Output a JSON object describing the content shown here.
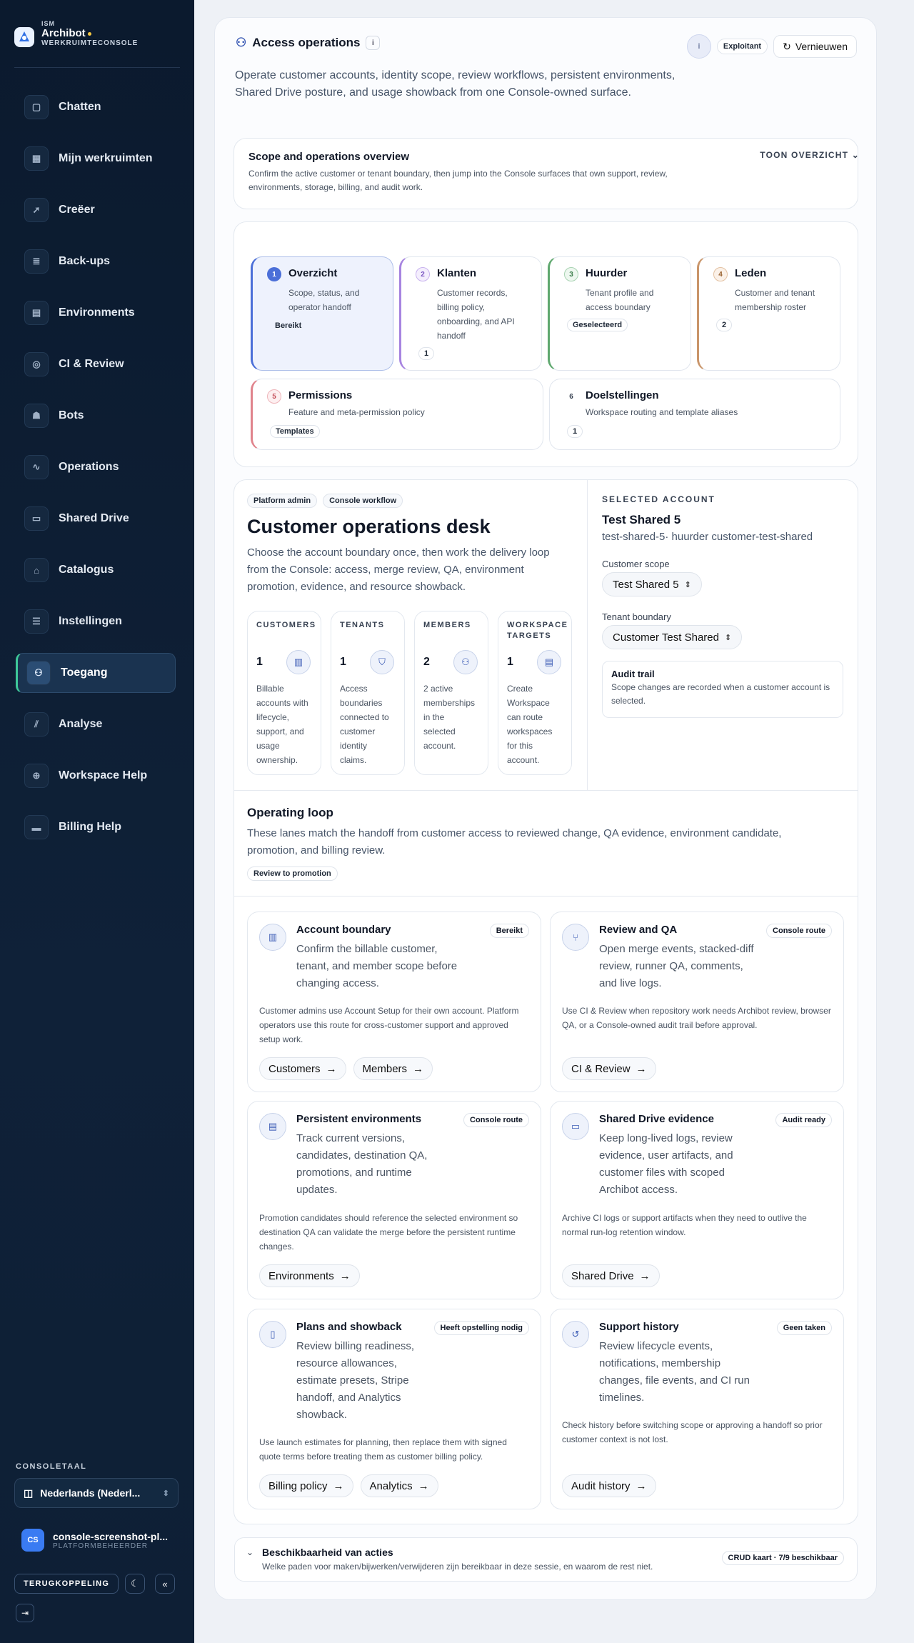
{
  "sidebar": {
    "brand_small": "ISM",
    "brand_name": "Archibot",
    "brand_sub": "WERKRUIMTECONSOLE",
    "items": [
      {
        "label": "Chatten",
        "icon": "chat-icon"
      },
      {
        "label": "Mijn werkruimten",
        "icon": "grid-icon"
      },
      {
        "label": "Creëer",
        "icon": "rocket-icon"
      },
      {
        "label": "Back-ups",
        "icon": "database-icon"
      },
      {
        "label": "Environments",
        "icon": "server-icon"
      },
      {
        "label": "CI & Review",
        "icon": "check-circle-icon"
      },
      {
        "label": "Bots",
        "icon": "bot-icon"
      },
      {
        "label": "Operations",
        "icon": "activity-icon"
      },
      {
        "label": "Shared Drive",
        "icon": "folder-icon"
      },
      {
        "label": "Catalogus",
        "icon": "store-icon"
      },
      {
        "label": "Instellingen",
        "icon": "sliders-icon"
      },
      {
        "label": "Toegang",
        "icon": "users-icon",
        "active": true
      },
      {
        "label": "Analyse",
        "icon": "chart-icon"
      },
      {
        "label": "Workspace Help",
        "icon": "lifebuoy-icon"
      },
      {
        "label": "Billing Help",
        "icon": "card-icon"
      }
    ],
    "lang_label": "CONSOLETAAL",
    "lang_value": "Nederlands (Nederl...",
    "user_initials": "CS",
    "user_name": "console-screenshot-pl...",
    "user_role": "PLATFORMBEHEERDER",
    "feedback": "TERUGKOPPELING"
  },
  "header": {
    "title": "Access operations",
    "role_badge": "Exploitant",
    "refresh": "Vernieuwen",
    "description": "Operate customer accounts, identity scope, review workflows, persistent environments, Shared Drive posture, and usage showback from one Console-owned surface."
  },
  "overview": {
    "title": "Scope and operations overview",
    "description": "Confirm the active customer or tenant boundary, then jump into the Console surfaces that own support, review, environments, storage, billing, and audit work.",
    "toggle": "TOON OVERZICHT"
  },
  "steps": [
    {
      "num": "1",
      "title": "Overzicht",
      "desc": "Scope, status, and operator handoff",
      "badge": "Bereikt"
    },
    {
      "num": "2",
      "title": "Klanten",
      "desc": "Customer records, billing policy, onboarding, and API handoff",
      "badge": "1"
    },
    {
      "num": "3",
      "title": "Huurder",
      "desc": "Tenant profile and access boundary",
      "badge": "Geselecteerd"
    },
    {
      "num": "4",
      "title": "Leden",
      "desc": "Customer and tenant membership roster",
      "badge": "2"
    },
    {
      "num": "5",
      "title": "Permissions",
      "desc": "Feature and meta-permission policy",
      "badge": "Templates"
    },
    {
      "num": "6",
      "title": "Doelstellingen",
      "desc": "Workspace routing and template aliases",
      "badge": "1"
    }
  ],
  "desk": {
    "tag1": "Platform admin",
    "tag2": "Console workflow",
    "title": "Customer operations desk",
    "description": "Choose the account boundary once, then work the delivery loop from the Console: access, merge review, QA, environment promotion, evidence, and resource showback.",
    "stats": [
      {
        "label": "CUSTOMERS",
        "value": "1",
        "desc": "Billable accounts with lifecycle, support, and usage ownership.",
        "icon": "building-icon"
      },
      {
        "label": "TENANTS",
        "value": "1",
        "desc": "Access boundaries connected to customer identity claims.",
        "icon": "shield-icon"
      },
      {
        "label": "MEMBERS",
        "value": "2",
        "desc": "2 active memberships in the selected account.",
        "icon": "users-icon"
      },
      {
        "label": "WORKSPACE TARGETS",
        "value": "1",
        "desc": "Create Workspace can route workspaces for this account.",
        "icon": "server-icon"
      }
    ]
  },
  "selected": {
    "label": "SELECTED ACCOUNT",
    "name": "Test Shared 5",
    "meta": "test-shared-5· huurder customer-test-shared",
    "scope_label": "Customer scope",
    "scope_value": "Test Shared 5",
    "tenant_label": "Tenant boundary",
    "tenant_value": "Customer Test Shared",
    "audit_title": "Audit trail",
    "audit_desc": "Scope changes are recorded when a customer account is selected."
  },
  "loop": {
    "title": "Operating loop",
    "description": "These lanes match the handoff from customer access to reviewed change, QA evidence, environment candidate, promotion, and billing review.",
    "tag": "Review to promotion"
  },
  "lanes": [
    {
      "title": "Account boundary",
      "badge": "Bereikt",
      "icon": "building-icon",
      "desc": "Confirm the billable customer, tenant, and member scope before changing access.",
      "note": "Customer admins use Account Setup for their own account. Platform operators use this route for cross-customer support and approved setup work.",
      "buttons": [
        "Customers",
        "Members"
      ]
    },
    {
      "title": "Review and QA",
      "badge": "Console route",
      "icon": "merge-icon",
      "desc": "Open merge events, stacked-diff review, runner QA, comments, and live logs.",
      "note": "Use CI & Review when repository work needs Archibot review, browser QA, or a Console-owned audit trail before approval.",
      "buttons": [
        "CI & Review"
      ]
    },
    {
      "title": "Persistent environments",
      "badge": "Console route",
      "icon": "server-icon",
      "desc": "Track current versions, candidates, destination QA, promotions, and runtime updates.",
      "note": "Promotion candidates should reference the selected environment so destination QA can validate the merge before the persistent runtime changes.",
      "buttons": [
        "Environments"
      ]
    },
    {
      "title": "Shared Drive evidence",
      "badge": "Audit ready",
      "icon": "folder-icon",
      "desc": "Keep long-lived logs, review evidence, user artifacts, and customer files with scoped Archibot access.",
      "note": "Archive CI logs or support artifacts when they need to outlive the normal run-log retention window.",
      "buttons": [
        "Shared Drive"
      ]
    },
    {
      "title": "Plans and showback",
      "badge": "Heeft opstelling nodig",
      "icon": "receipt-icon",
      "desc": "Review billing readiness, resource allowances, estimate presets, Stripe handoff, and Analytics showback.",
      "note": "Use launch estimates for planning, then replace them with signed quote terms before treating them as customer billing policy.",
      "buttons": [
        "Billing policy",
        "Analytics"
      ]
    },
    {
      "title": "Support history",
      "badge": "Geen taken",
      "icon": "history-icon",
      "desc": "Review lifecycle events, notifications, membership changes, file events, and CI run timelines.",
      "note": "Check history before switching scope or approving a handoff so prior customer context is not lost.",
      "buttons": [
        "Audit history"
      ]
    }
  ],
  "availability": {
    "title": "Beschikbaarheid van acties",
    "description": "Welke paden voor maken/bijwerken/verwijderen zijn bereikbaar in deze sessie, en waarom de rest niet.",
    "badge": "CRUD kaart · 7/9 beschikbaar"
  },
  "colors": {
    "sidebar_bg": "#0f2138",
    "active_accent": "#3ec99a",
    "step1": "#4b6fd8",
    "step2": "#a784e0",
    "step3": "#5fa86f",
    "step4": "#c9956a",
    "step5": "#e0838c"
  }
}
